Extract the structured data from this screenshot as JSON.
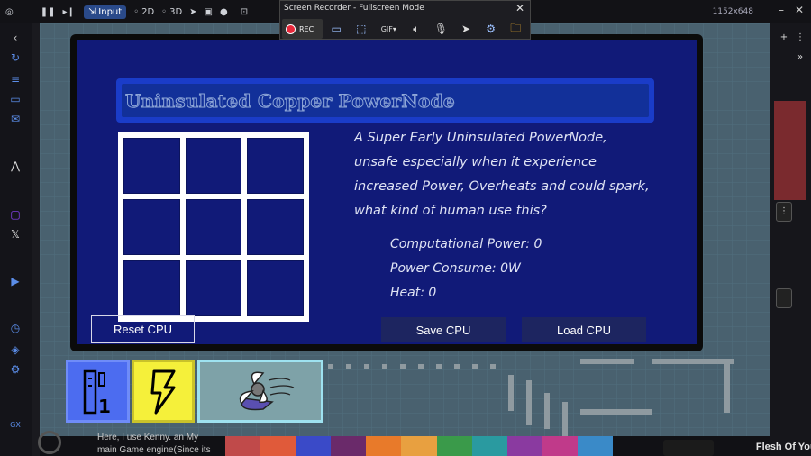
{
  "toolbar": {
    "input_label": "Input",
    "mode_2d": "2D",
    "mode_3d": "3D",
    "dimensions": "1152x648"
  },
  "recorder": {
    "title": "Screen Recorder - Fullscreen Mode",
    "rec_label": "REC",
    "close": "✕"
  },
  "panel": {
    "title": "Uninsulated Copper PowerNode",
    "description": "A Super Early Uninsulated PowerNode, unsafe especially when it experience increased Power, Overheats and could spark, what kind of human use this?",
    "stats": {
      "computational_power": "Computational Power: 0",
      "power_consume": "Power Consume: 0W",
      "heat": "Heat: 0"
    },
    "buttons": {
      "reset": "Reset CPU",
      "save": "Save CPU",
      "load": "Load CPU"
    }
  },
  "hotbar": {
    "slot1_text": "1"
  },
  "bottom": {
    "text_line1": "Here, I use Kenny. an My",
    "text_line2": "main Game engine(Since its",
    "right_label": "Flesh Of Your"
  },
  "colors": {
    "panel_bg": "#111a78",
    "title_border": "#1a3cc8",
    "rec_red": "#e8283a",
    "slot_blue": "#4c6cf0",
    "slot_yellow": "#f5f03a",
    "slot_teal": "#7ea2a8"
  }
}
